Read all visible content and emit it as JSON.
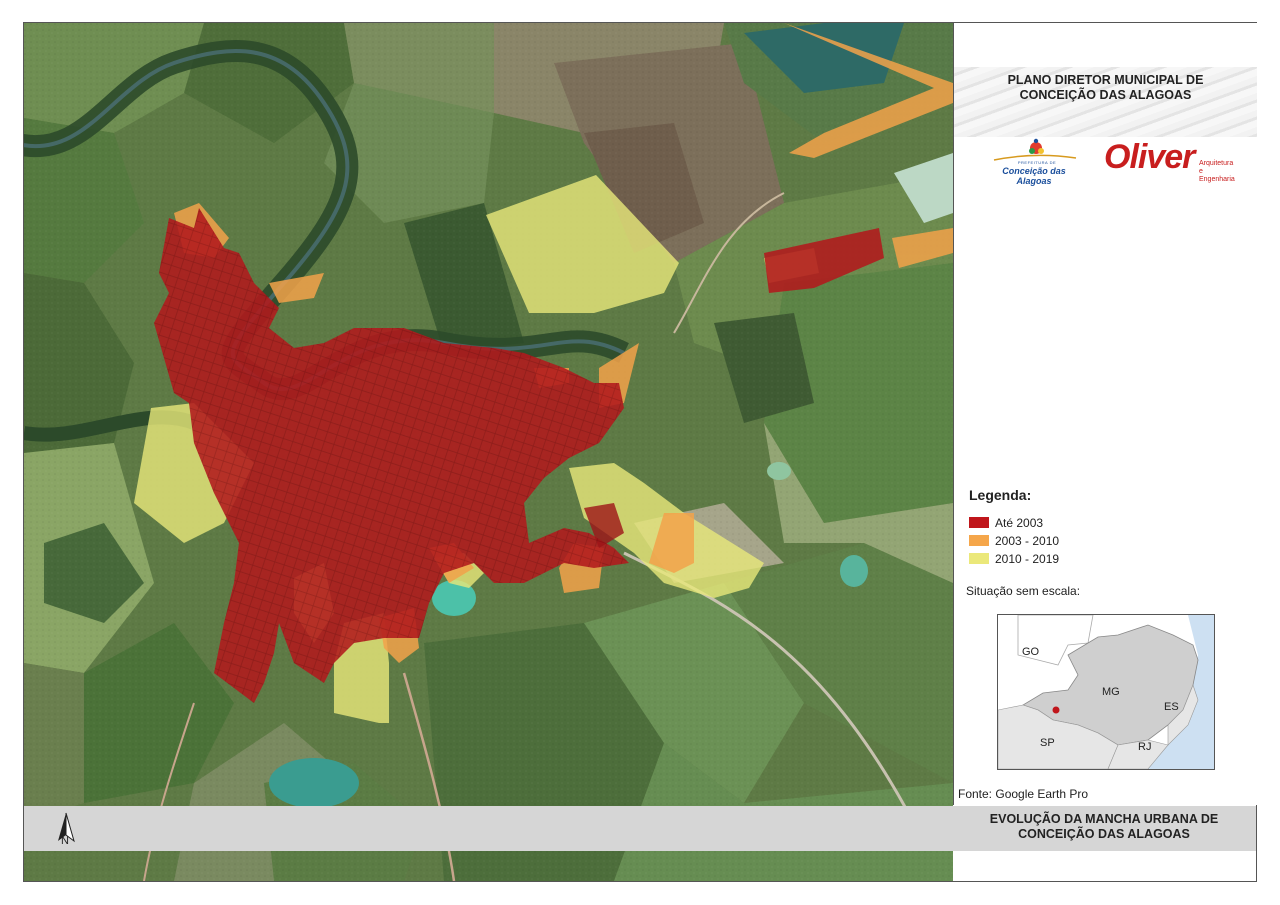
{
  "header": {
    "title_line1": "PLANO DIRETOR MUNICIPAL DE",
    "title_line2": "CONCEIÇÃO DAS ALAGOAS"
  },
  "logos": {
    "prefeitura_small": "PREFEITURA DE",
    "prefeitura_name": "Conceição das Alagoas",
    "oliver_name": "Oliver",
    "oliver_sub_line1": "Arquitetura e",
    "oliver_sub_line2": "Engenharia"
  },
  "legend": {
    "title": "Legenda:",
    "items": [
      {
        "label": "Até 2003",
        "color": "#c0161b"
      },
      {
        "label": "2003 - 2010",
        "color": "#f5a64a"
      },
      {
        "label": "2010 - 2019",
        "color": "#ebe87a"
      }
    ]
  },
  "situation": {
    "title": "Situação sem escala:",
    "states": [
      "GO",
      "MG",
      "ES",
      "SP",
      "RJ"
    ]
  },
  "source": "Fonte: Google Earth Pro",
  "footer": {
    "title_line1": "EVOLUÇÃO DA MANCHA URBANA DE",
    "title_line2": "CONCEIÇÃO DAS ALAGOAS",
    "north_label": "N"
  },
  "colors": {
    "field_dark": "#3f5d34",
    "field_light": "#7a9c5a",
    "water": "#4fb3a0",
    "urban_red": "#b01c1f",
    "orange": "#f0a24c",
    "yellow": "#e3e37a"
  }
}
